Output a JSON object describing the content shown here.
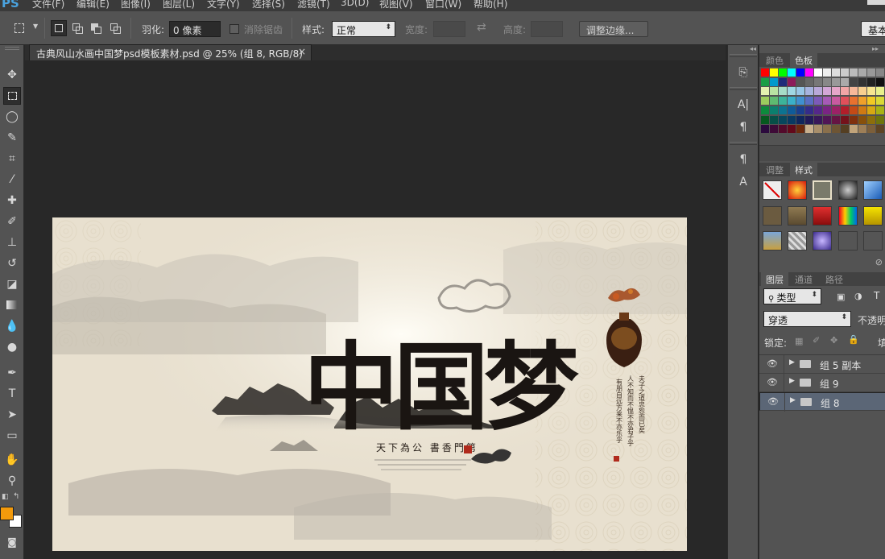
{
  "app": {
    "logo": "PS"
  },
  "menu": [
    "文件(F)",
    "编辑(E)",
    "图像(I)",
    "图层(L)",
    "文字(Y)",
    "选择(S)",
    "滤镜(T)",
    "3D(D)",
    "视图(V)",
    "窗口(W)",
    "帮助(H)"
  ],
  "options": {
    "feather_label": "羽化:",
    "feather_value": "0 像素",
    "antialias_label": "消除锯齿",
    "style_label": "样式:",
    "style_value": "正常",
    "width_label": "宽度:",
    "height_label": "高度:",
    "refine_button": "调整边缘...",
    "workspace_button": "基本"
  },
  "document": {
    "tab_title": "古典风山水画中国梦psd模板素材.psd @ 25% (组 8, RGB/8)",
    "close_glyph": "×"
  },
  "artwork": {
    "title": "中国梦",
    "slogan": "天下為公 書香門第",
    "poem_col1": "夫子之道忠恕而已矣",
    "poem_col2": "人不知而不愠不亦君子乎",
    "poem_col3": "有朋自远方来不亦乐乎"
  },
  "panels": {
    "color_tabs": [
      "颜色",
      "色板"
    ],
    "style_tabs": [
      "调整",
      "样式"
    ],
    "layer_tabs": [
      "图层",
      "通道",
      "路径"
    ],
    "kind_filter": "类型",
    "blend_mode": "穿透",
    "opacity_label": "不透明",
    "lock_label": "锁定:",
    "fill_label": "填",
    "layers": [
      {
        "name": "组 5 副本",
        "selected": false
      },
      {
        "name": "组 9",
        "selected": false
      },
      {
        "name": "组 8",
        "selected": true
      }
    ]
  },
  "colors": {
    "foreground": "#f29a0c",
    "background": "#ffffff",
    "swatches_row1": [
      "#ff0000",
      "#ffff00",
      "#00ff00",
      "#00ffff",
      "#0000ff",
      "#ff00ff",
      "#ffffff",
      "#eeeeee",
      "#dddddd",
      "#cccccc",
      "#bbbbbb",
      "#aaaaaa",
      "#999999",
      "#888888"
    ],
    "swatches_row2": [
      "#1a9d46",
      "#0099cc",
      "#1e2b7a",
      "#8c1b5a",
      "#555555",
      "#666666",
      "#777777",
      "#888888",
      "#999999",
      "#aaaaaa",
      "#444444",
      "#333333",
      "#222222",
      "#111111"
    ],
    "swatches_row3": [
      "#e3f0b0",
      "#b9e3a3",
      "#a6dcc8",
      "#9fd7e3",
      "#98c6e6",
      "#a7b3df",
      "#b9a8d9",
      "#d3a6d7",
      "#e6a6c9",
      "#f2a6a6",
      "#f7b899",
      "#f8cf8f",
      "#f8e58f",
      "#e8f08c"
    ],
    "swatches_row4": [
      "#9ccc5e",
      "#5eba71",
      "#3cb39a",
      "#3ab0c9",
      "#3f90d0",
      "#5a6fc4",
      "#7c5ab9",
      "#a65ab6",
      "#c95aa0",
      "#e0505a",
      "#e8712f",
      "#efa02a",
      "#f2c923",
      "#d9d935"
    ],
    "swatches_row5": [
      "#0d8a3c",
      "#0b7f6e",
      "#0c7391",
      "#0f5b99",
      "#1a3f8f",
      "#352c8a",
      "#55278a",
      "#7a2484",
      "#9c2166",
      "#b21e2a",
      "#c44a16",
      "#cf7a13",
      "#d8a812",
      "#a8b314"
    ],
    "swatches_row6": [
      "#06591f",
      "#064f47",
      "#06475d",
      "#083a63",
      "#0f275d",
      "#221b59",
      "#38185a",
      "#501656",
      "#661443",
      "#74121b",
      "#80300d",
      "#87500b",
      "#8d6e0b",
      "#6e750c"
    ],
    "swatches_row7": [
      "#2b0a3d",
      "#3e0a37",
      "#530a2b",
      "#63091a",
      "#6b2a0d",
      "#c9b18e",
      "#a88f6b",
      "#8a704c",
      "#6e5534",
      "#553f22",
      "#c2a47a",
      "#9e7f57",
      "#7c5f3a",
      "#5e4424"
    ]
  }
}
